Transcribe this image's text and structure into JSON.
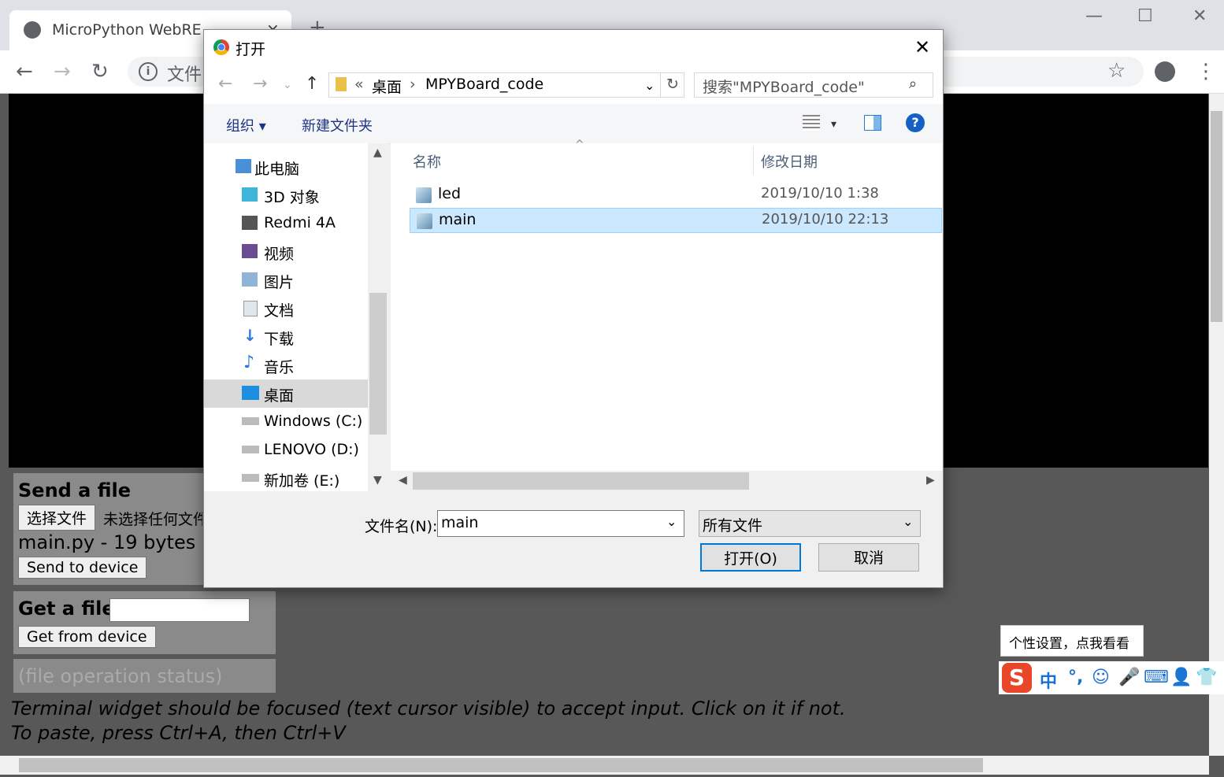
{
  "browser": {
    "tab_title": "MicroPython WebREPL",
    "tab_close": "×",
    "new_tab": "+",
    "window_controls": {
      "minimize": "—",
      "maximize": "☐",
      "close": "✕"
    },
    "nav": {
      "back": "←",
      "forward": "→",
      "reload": "↻"
    },
    "url_prefix": "文件",
    "bookmark": "☆",
    "menu": "⋮"
  },
  "page": {
    "send": {
      "title": "Send a file",
      "choose_button": "选择文件",
      "no_file": "未选择任何文件",
      "file_info": "main.py - 19 bytes",
      "send_button": "Send to device"
    },
    "get": {
      "title": "Get a file",
      "get_button": "Get from device"
    },
    "status": "(file operation status)",
    "note1": "Terminal widget should be focused (text cursor visible) to accept input. Click on it if not.",
    "note2": "To paste, press Ctrl+A, then Ctrl+V"
  },
  "dialog": {
    "title": "打开",
    "breadcrumb_prefix": "«",
    "breadcrumb": [
      "桌面",
      "MPYBoard_code"
    ],
    "search_placeholder": "搜索\"MPYBoard_code\"",
    "organize": "组织 ▾",
    "new_folder": "新建文件夹",
    "help": "?",
    "tree": [
      {
        "label": "此电脑",
        "icon": "computer-icon"
      },
      {
        "label": "3D 对象",
        "icon": "3d-objects-icon"
      },
      {
        "label": "Redmi 4A",
        "icon": "phone-icon"
      },
      {
        "label": "视频",
        "icon": "video-icon"
      },
      {
        "label": "图片",
        "icon": "pictures-icon"
      },
      {
        "label": "文档",
        "icon": "documents-icon"
      },
      {
        "label": "下载",
        "icon": "download-icon"
      },
      {
        "label": "音乐",
        "icon": "music-icon"
      },
      {
        "label": "桌面",
        "icon": "desktop-icon"
      },
      {
        "label": "Windows (C:)",
        "icon": "drive-icon"
      },
      {
        "label": "LENOVO (D:)",
        "icon": "drive-icon"
      },
      {
        "label": "新加卷 (E:)",
        "icon": "drive-icon"
      }
    ],
    "columns": {
      "name": "名称",
      "modified": "修改日期"
    },
    "files": [
      {
        "name": "led",
        "modified": "2019/10/10 1:38"
      },
      {
        "name": "main",
        "modified": "2019/10/10 22:13"
      }
    ],
    "filename_label": "文件名(N):",
    "filename_value": "main",
    "filetype": "所有文件",
    "open_button": "打开(O)",
    "cancel_button": "取消"
  },
  "ime": {
    "tooltip": "个性设置，点我看看",
    "logo": "S",
    "items": [
      "中",
      "°,",
      "☺",
      "🎤",
      "⌨",
      "👤",
      "👕"
    ]
  },
  "colors": {
    "accent": "#0078d7",
    "selection": "#cce8ff",
    "panel": "#8a8a8a",
    "page_bg": "#585858",
    "ime": "#1a6fd1",
    "sogou": "#e8472a"
  }
}
